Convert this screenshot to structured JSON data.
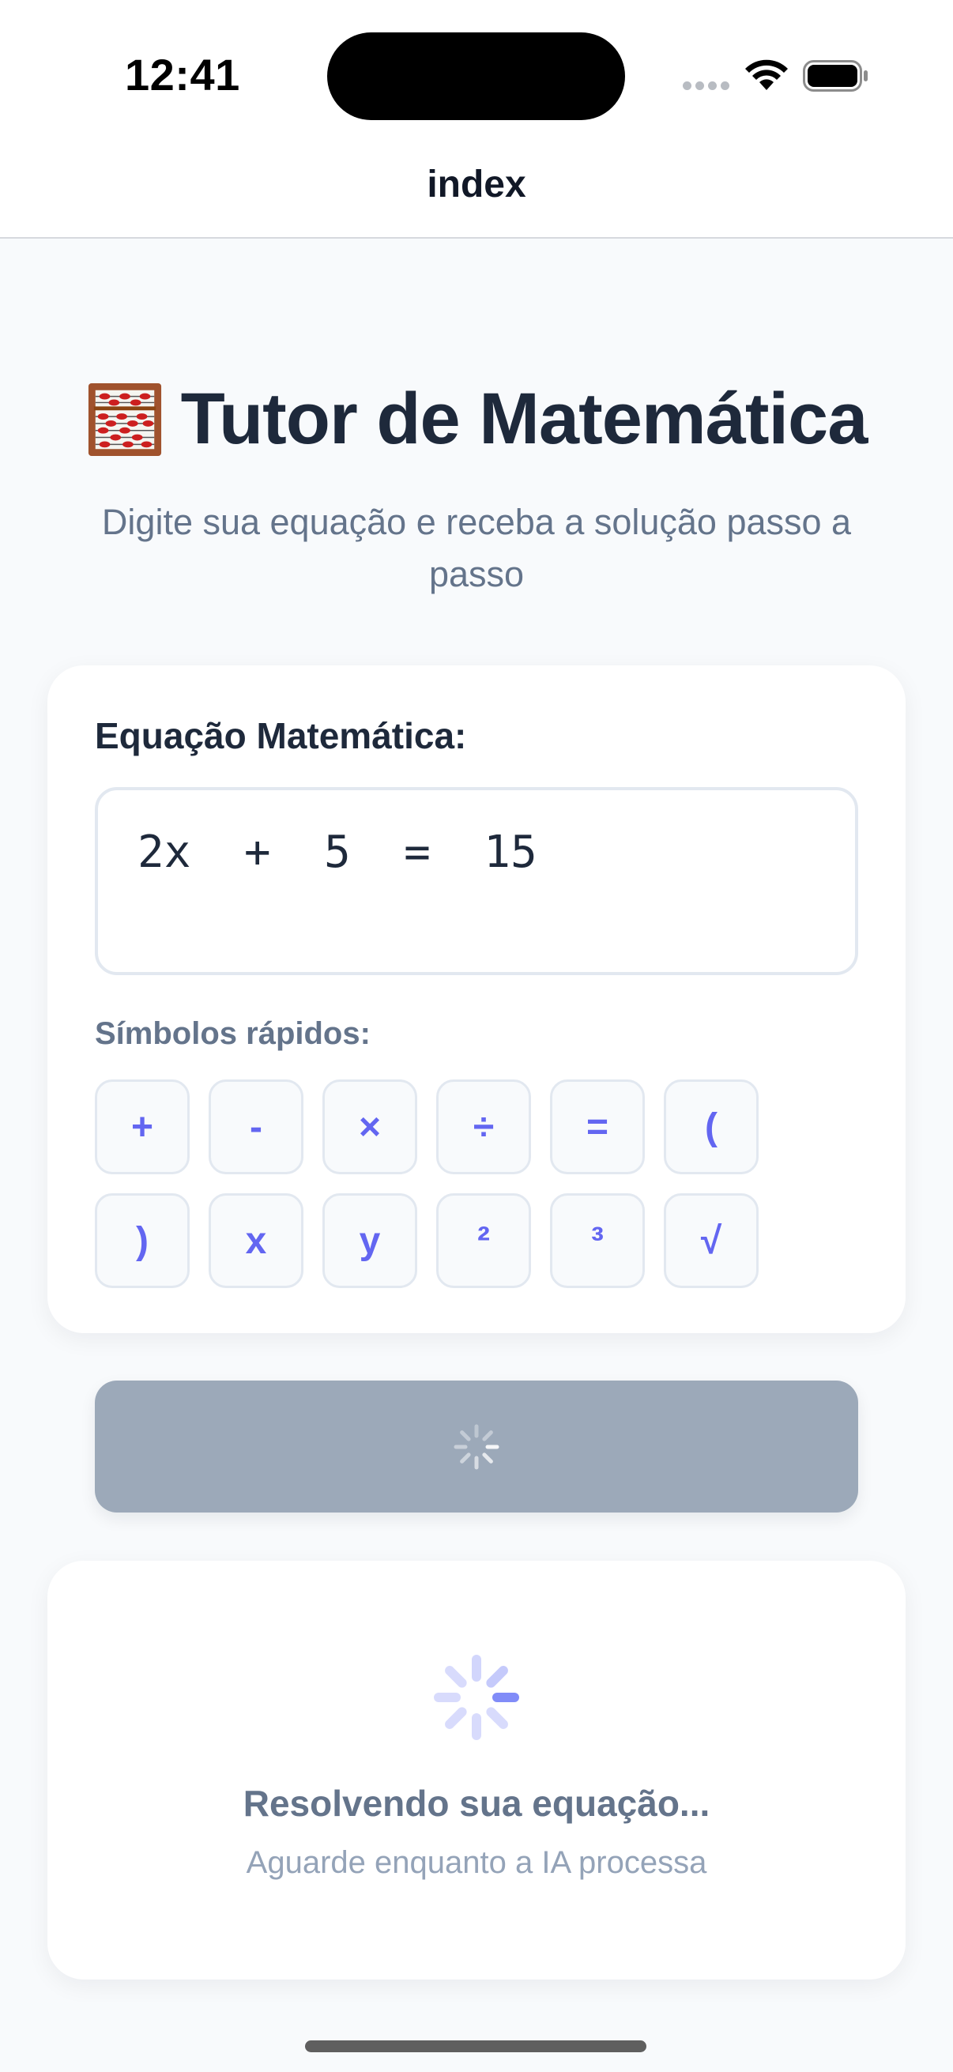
{
  "status_bar": {
    "time": "12:41"
  },
  "nav": {
    "title": "index"
  },
  "header": {
    "icon": "abacus-icon",
    "title": "Tutor de Matemática",
    "subtitle": "Digite sua equação e receba a solução passo a passo"
  },
  "equation": {
    "label": "Equação Matemática:",
    "value": "2x + 5 = 15"
  },
  "symbols": {
    "label": "Símbolos rápidos:",
    "items": [
      "+",
      "-",
      "×",
      "÷",
      "=",
      "(",
      ")",
      "x",
      "y",
      "²",
      "³",
      "√"
    ]
  },
  "solve_button": {
    "state": "loading",
    "color": "#9ca9b9"
  },
  "loading": {
    "title": "Resolvendo sua equação...",
    "subtitle": "Aguarde enquanto a IA processa"
  },
  "colors": {
    "accent": "#6366f1",
    "text": "#1e293b",
    "muted": "#64748b",
    "background": "#f8fafc"
  }
}
